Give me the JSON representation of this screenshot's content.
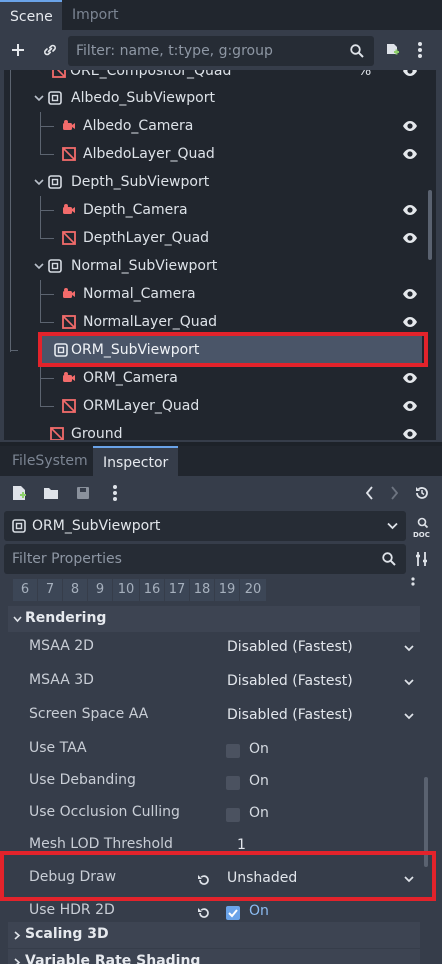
{
  "scene_dock": {
    "tabs": [
      {
        "label": "Scene",
        "active": true
      },
      {
        "label": "Import",
        "active": false
      }
    ],
    "filter_placeholder": "Filter: name, t:type, g:group",
    "tree": [
      {
        "label": "ORE_Compositor_Quad",
        "icon": "mesh-icon",
        "depth": 1,
        "suffix": "%"
      },
      {
        "label": "Albedo_SubViewport",
        "icon": "subviewport-icon",
        "depth": 1,
        "expanded": true
      },
      {
        "label": "Albedo_Camera",
        "icon": "camera-icon",
        "depth": 2
      },
      {
        "label": "AlbedoLayer_Quad",
        "icon": "mesh-icon",
        "depth": 2
      },
      {
        "label": "Depth_SubViewport",
        "icon": "subviewport-icon",
        "depth": 1,
        "expanded": true
      },
      {
        "label": "Depth_Camera",
        "icon": "camera-icon",
        "depth": 2
      },
      {
        "label": "DepthLayer_Quad",
        "icon": "mesh-icon",
        "depth": 2
      },
      {
        "label": "Normal_SubViewport",
        "icon": "subviewport-icon",
        "depth": 1,
        "expanded": true
      },
      {
        "label": "Normal_Camera",
        "icon": "camera-icon",
        "depth": 2
      },
      {
        "label": "NormalLayer_Quad",
        "icon": "mesh-icon",
        "depth": 2
      },
      {
        "label": "ORM_SubViewport",
        "icon": "subviewport-icon",
        "depth": 1,
        "selected": true
      },
      {
        "label": "ORM_Camera",
        "icon": "camera-icon",
        "depth": 2
      },
      {
        "label": "ORMLayer_Quad",
        "icon": "mesh-icon",
        "depth": 2
      },
      {
        "label": "Ground",
        "icon": "mesh-icon",
        "depth": 0
      }
    ]
  },
  "inspector_dock": {
    "tabs": [
      {
        "label": "FileSystem",
        "active": false
      },
      {
        "label": "Inspector",
        "active": true
      }
    ],
    "object_name": "ORM_SubViewport",
    "filter_placeholder": "Filter Properties",
    "layer_numbers": [
      "6",
      "7",
      "8",
      "9",
      "10",
      "16",
      "17",
      "18",
      "19",
      "20"
    ],
    "section_title": "Rendering",
    "properties": [
      {
        "label": "MSAA 2D",
        "type": "dropdown",
        "value": "Disabled (Fastest)"
      },
      {
        "label": "MSAA 3D",
        "type": "dropdown",
        "value": "Disabled (Fastest)"
      },
      {
        "label": "Screen Space AA",
        "type": "dropdown",
        "value": "Disabled (Fastest)"
      },
      {
        "label": "Use TAA",
        "type": "checkbox",
        "value": "On",
        "checked": false
      },
      {
        "label": "Use Debanding",
        "type": "checkbox",
        "value": "On",
        "checked": false
      },
      {
        "label": "Use Occlusion Culling",
        "type": "checkbox",
        "value": "On",
        "checked": false
      },
      {
        "label": "Mesh LOD Threshold",
        "type": "number",
        "value": "1"
      },
      {
        "label": "Debug Draw",
        "type": "dropdown",
        "value": "Unshaded",
        "revert": true
      },
      {
        "label": "Use HDR 2D",
        "type": "checkbox",
        "value": "On",
        "checked": true,
        "revert": true
      }
    ],
    "collapsed_sections": [
      "Scaling 3D",
      "Variable Rate Shading"
    ]
  },
  "colors": {
    "highlight": "#e3232b",
    "accent": "#6aa3e8",
    "node_red": "#f26b6b"
  }
}
